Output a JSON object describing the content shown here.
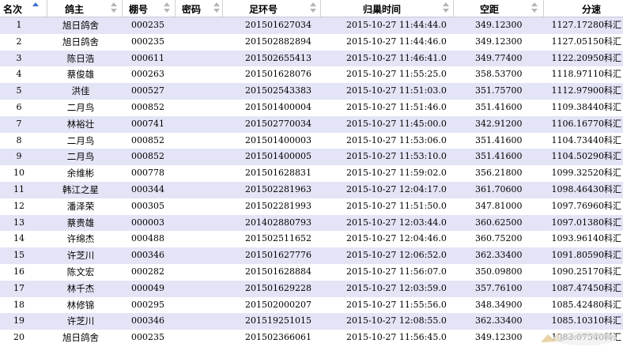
{
  "columns": [
    {
      "label": "名次",
      "sort": "asc"
    },
    {
      "label": "鸽主",
      "sort": "none"
    },
    {
      "label": "棚号",
      "sort": "none"
    },
    {
      "label": "密码",
      "sort": "none"
    },
    {
      "label": "足环号",
      "sort": "none"
    },
    {
      "label": "归巢时间",
      "sort": "none"
    },
    {
      "label": "空距",
      "sort": "none"
    },
    {
      "label": "分速",
      "sort": "none"
    }
  ],
  "speed_unit": "科汇",
  "rows": [
    {
      "rank": "1",
      "owner": "旭日鸽舍",
      "loft": "000235",
      "ring": "201501627034",
      "time": "2015-10-27 11:44:44.0",
      "distance": "349.12300",
      "speed": "1127.17280"
    },
    {
      "rank": "2",
      "owner": "旭日鸽舍",
      "loft": "000235",
      "ring": "201502882894",
      "time": "2015-10-27 11:44:46.0",
      "distance": "349.12300",
      "speed": "1127.05150"
    },
    {
      "rank": "3",
      "owner": "陈日浩",
      "loft": "000611",
      "ring": "201502655413",
      "time": "2015-10-27 11:46:41.0",
      "distance": "349.77400",
      "speed": "1122.20950"
    },
    {
      "rank": "4",
      "owner": "蔡俊雄",
      "loft": "000263",
      "ring": "201501628076",
      "time": "2015-10-27 11:55:25.0",
      "distance": "358.53700",
      "speed": "1118.97110"
    },
    {
      "rank": "5",
      "owner": "洪佳",
      "loft": "000527",
      "ring": "201502543383",
      "time": "2015-10-27 11:51:03.0",
      "distance": "351.75700",
      "speed": "1112.97900"
    },
    {
      "rank": "6",
      "owner": "二月鸟",
      "loft": "000852",
      "ring": "201501400004",
      "time": "2015-10-27 11:51:46.0",
      "distance": "351.41600",
      "speed": "1109.38440"
    },
    {
      "rank": "7",
      "owner": "林裕壮",
      "loft": "000741",
      "ring": "201502770034",
      "time": "2015-10-27 11:45:00.0",
      "distance": "342.91200",
      "speed": "1106.16770"
    },
    {
      "rank": "8",
      "owner": "二月鸟",
      "loft": "000852",
      "ring": "201501400003",
      "time": "2015-10-27 11:53:06.0",
      "distance": "351.41600",
      "speed": "1104.73440"
    },
    {
      "rank": "9",
      "owner": "二月鸟",
      "loft": "000852",
      "ring": "201501400005",
      "time": "2015-10-27 11:53:10.0",
      "distance": "351.41600",
      "speed": "1104.50290"
    },
    {
      "rank": "10",
      "owner": "余维彬",
      "loft": "000778",
      "ring": "201501628831",
      "time": "2015-10-27 11:59:02.0",
      "distance": "356.21800",
      "speed": "1099.32520"
    },
    {
      "rank": "11",
      "owner": "韩江之星",
      "loft": "000344",
      "ring": "201502281963",
      "time": "2015-10-27 12:04:17.0",
      "distance": "361.70600",
      "speed": "1098.46430"
    },
    {
      "rank": "12",
      "owner": "潘泽荣",
      "loft": "000305",
      "ring": "201502281993",
      "time": "2015-10-27 11:51:50.0",
      "distance": "347.81000",
      "speed": "1097.76960"
    },
    {
      "rank": "13",
      "owner": "蔡贵雄",
      "loft": "000003",
      "ring": "201402880793",
      "time": "2015-10-27 12:03:44.0",
      "distance": "360.62500",
      "speed": "1097.01380"
    },
    {
      "rank": "14",
      "owner": "许绵杰",
      "loft": "000488",
      "ring": "201502511652",
      "time": "2015-10-27 12:04:46.0",
      "distance": "360.75200",
      "speed": "1093.96140"
    },
    {
      "rank": "15",
      "owner": "许芝川",
      "loft": "000346",
      "ring": "201501627776",
      "time": "2015-10-27 12:06:52.0",
      "distance": "362.33400",
      "speed": "1091.80590"
    },
    {
      "rank": "16",
      "owner": "陈文宏",
      "loft": "000282",
      "ring": "201501628884",
      "time": "2015-10-27 11:56:07.0",
      "distance": "350.09800",
      "speed": "1090.25170"
    },
    {
      "rank": "17",
      "owner": "林千杰",
      "loft": "000049",
      "ring": "201501629228",
      "time": "2015-10-27 12:03:59.0",
      "distance": "357.76100",
      "speed": "1087.47450"
    },
    {
      "rank": "18",
      "owner": "林修锦",
      "loft": "000295",
      "ring": "201502000207",
      "time": "2015-10-27 11:55:56.0",
      "distance": "348.34900",
      "speed": "1085.42480"
    },
    {
      "rank": "19",
      "owner": "许芝川",
      "loft": "000346",
      "ring": "201519251015",
      "time": "2015-10-27 12:08:55.0",
      "distance": "362.33400",
      "speed": "1085.10310"
    },
    {
      "rank": "20",
      "owner": "旭日鸽舍",
      "loft": "000235",
      "ring": "201502366061",
      "time": "2015-10-27 11:56:45.0",
      "distance": "349.12300",
      "speed": "1083.07540"
    }
  ]
}
